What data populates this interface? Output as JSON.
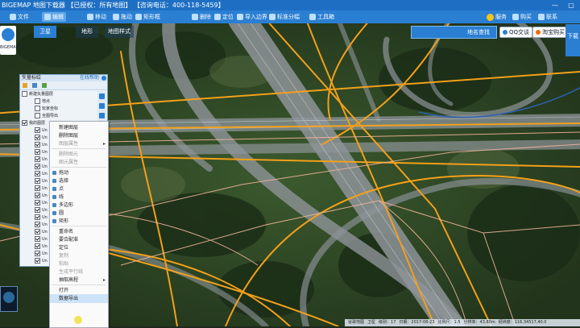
{
  "window": {
    "title": "BIGEMAP 地图下载器 【已授权：所有地图】 【咨询电话：400-118-5459】",
    "controls": [
      "—",
      "▢"
    ]
  },
  "toolbar": {
    "items": [
      {
        "label": "文件",
        "icon": "file-icon"
      },
      {
        "label": "编辑",
        "icon": "edit-icon",
        "selected": true
      },
      {
        "label": "移动",
        "icon": "move-icon"
      },
      {
        "label": "拖动",
        "icon": "hand-icon"
      },
      {
        "label": "矩形框",
        "icon": "rect-select-icon"
      },
      {
        "label": "删除",
        "icon": "delete-icon"
      },
      {
        "label": "定位",
        "icon": "locate-icon"
      },
      {
        "label": "导入边界",
        "icon": "import-boundary-icon"
      },
      {
        "label": "标准分幅",
        "icon": "grid-icon"
      },
      {
        "label": "工具箱",
        "icon": "toolbox-icon"
      }
    ],
    "right": [
      {
        "label": "服务",
        "icon": "smile-icon"
      },
      {
        "label": "购买",
        "icon": "cart-icon"
      },
      {
        "label": "联系",
        "icon": "contact-icon"
      }
    ]
  },
  "map_tabs": [
    {
      "label": "卫星",
      "selected": true
    },
    {
      "label": "地形",
      "selected": false
    },
    {
      "label": "地图样式",
      "selected": false
    }
  ],
  "map_search": {
    "label": "地名查找"
  },
  "top_buttons": [
    {
      "label": "QQ交谈",
      "icon": "qq-icon"
    },
    {
      "label": "淘宝购买",
      "icon": "taobao-icon"
    }
  ],
  "right_panel": {
    "label": "下载"
  },
  "logo": {
    "label": "BIGEMAP"
  },
  "layer_panel": {
    "title": "矢量标绘",
    "link": "在线帮助",
    "tree": [
      {
        "label": "新建矢量图层",
        "checked": false,
        "indent": 0
      },
      {
        "label": "地点",
        "checked": false,
        "indent": 1
      },
      {
        "label": "玩家坐标",
        "checked": false,
        "indent": 1
      },
      {
        "label": "全图导出",
        "checked": false,
        "indent": 1
      },
      {
        "label": "我的图层",
        "checked": true,
        "indent": 0
      },
      {
        "label": "Un",
        "checked": true,
        "indent": 1
      },
      {
        "label": "Un",
        "checked": true,
        "indent": 1
      },
      {
        "label": "Un",
        "checked": true,
        "indent": 1
      },
      {
        "label": "Un",
        "checked": true,
        "indent": 1
      },
      {
        "label": "Un",
        "checked": true,
        "indent": 1
      },
      {
        "label": "Un",
        "checked": true,
        "indent": 1
      },
      {
        "label": "Un",
        "checked": true,
        "indent": 1
      },
      {
        "label": "Un",
        "checked": true,
        "indent": 1
      },
      {
        "label": "Un",
        "checked": true,
        "indent": 1
      },
      {
        "label": "Un",
        "checked": true,
        "indent": 1
      },
      {
        "label": "Un",
        "checked": true,
        "indent": 1
      },
      {
        "label": "Un",
        "checked": true,
        "indent": 1
      },
      {
        "label": "Un",
        "checked": true,
        "indent": 1
      },
      {
        "label": "Un",
        "checked": true,
        "indent": 1
      },
      {
        "label": "Un",
        "checked": true,
        "indent": 1
      },
      {
        "label": "Un",
        "checked": true,
        "indent": 1
      },
      {
        "label": "Un",
        "checked": true,
        "indent": 1
      },
      {
        "label": "Un",
        "checked": true,
        "indent": 1
      },
      {
        "label": "Un",
        "checked": true,
        "indent": 1
      }
    ]
  },
  "context_menu": [
    {
      "label": "新建图层",
      "icon": "",
      "disabled": false
    },
    {
      "label": "删除图层",
      "icon": "",
      "disabled": false
    },
    {
      "label": "图层属性",
      "icon": "",
      "disabled": true,
      "submenu": true
    },
    {
      "label": "",
      "separator": true
    },
    {
      "label": "删除图元",
      "icon": "",
      "disabled": true
    },
    {
      "label": "图元属性",
      "icon": "",
      "disabled": true
    },
    {
      "label": "",
      "separator": true
    },
    {
      "label": "拖动",
      "icon": "hand-icon",
      "disabled": false
    },
    {
      "label": "选择",
      "icon": "pointer-icon",
      "disabled": false
    },
    {
      "label": "点",
      "icon": "point-icon",
      "disabled": false
    },
    {
      "label": "线",
      "icon": "line-icon",
      "disabled": false
    },
    {
      "label": "多边形",
      "icon": "polygon-icon",
      "disabled": false
    },
    {
      "label": "圆",
      "icon": "circle-icon",
      "disabled": false
    },
    {
      "label": "矩形",
      "icon": "rectangle-icon",
      "disabled": false
    },
    {
      "label": "",
      "separator": true
    },
    {
      "label": "重命名",
      "icon": "",
      "disabled": false
    },
    {
      "label": "要合配准",
      "icon": "",
      "disabled": false
    },
    {
      "label": "定位",
      "icon": "",
      "disabled": false
    },
    {
      "label": "复制",
      "icon": "",
      "disabled": true
    },
    {
      "label": "粘贴",
      "icon": "",
      "disabled": true
    },
    {
      "label": "生成平行线",
      "icon": "",
      "disabled": true
    },
    {
      "label": "抽取高程",
      "icon": "",
      "disabled": false,
      "submenu": true
    },
    {
      "label": "",
      "separator": true
    },
    {
      "label": "打开",
      "icon": "",
      "disabled": false
    },
    {
      "label": "数据导出",
      "icon": "",
      "disabled": false,
      "highlighted": true
    }
  ],
  "status_bar": {
    "items": [
      "谷歌地图",
      "卫星",
      "级别：17",
      "日期：2017-08-23",
      "比例尺：1:5",
      "分辨率：43.80m",
      "经纬度：116.34517,40.0"
    ]
  },
  "colors": {
    "accent": "#2a7fd3",
    "road_orange": "#f2a01a",
    "road_pink": "#f0b49a"
  }
}
